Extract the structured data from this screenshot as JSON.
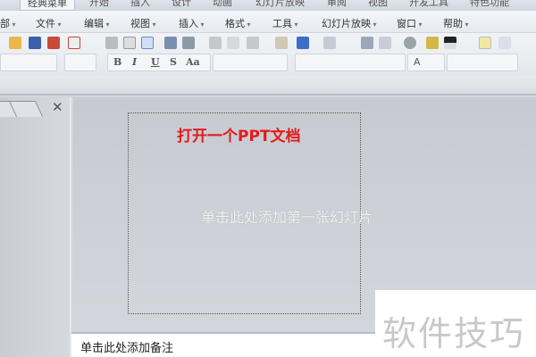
{
  "ribbon_tabs": [
    "经典菜单",
    "开始",
    "插入",
    "设计",
    "动画",
    "幻灯片放映",
    "审阅",
    "视图",
    "开发工具",
    "特色功能"
  ],
  "menu_items": [
    "部",
    "文件",
    "编辑",
    "视图",
    "插入",
    "格式",
    "工具",
    "幻灯片放映",
    "窗口",
    "帮助"
  ],
  "format_buttons": {
    "bold": "B",
    "italic": "I",
    "underline": "U",
    "shadow": "S",
    "case": "Aa",
    "font_color": "A"
  },
  "annotation": "打开一个PPT文档",
  "slide_placeholder": "单击此处添加第一张幻灯片",
  "notes_placeholder": "单击此处添加备注",
  "watermark": "软件技巧",
  "colors": {
    "annotation": "#e21b1b"
  }
}
